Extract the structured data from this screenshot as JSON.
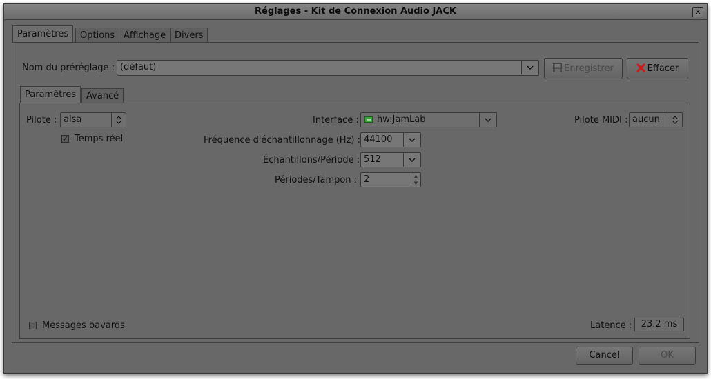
{
  "window": {
    "title": "Réglages - Kit de Connexion Audio JACK",
    "close_glyph": "✕"
  },
  "main_tabs": [
    {
      "label": "Paramètres",
      "active": true
    },
    {
      "label": "Options",
      "active": false
    },
    {
      "label": "Affichage",
      "active": false
    },
    {
      "label": "Divers",
      "active": false
    }
  ],
  "preset": {
    "label": "Nom du préréglage :",
    "value": "(défaut)",
    "save_label": "Enregistrer",
    "save_icon": "floppy-icon",
    "save_disabled": true,
    "delete_label": "Effacer",
    "delete_icon": "red-x-icon"
  },
  "sub_tabs": [
    {
      "label": "Paramètres",
      "active": true
    },
    {
      "label": "Avancé",
      "active": false
    }
  ],
  "settings": {
    "driver_label": "Pilote :",
    "driver_value": "alsa",
    "realtime_label": "Temps réel",
    "realtime_checked": true,
    "interface_label": "Interface :",
    "interface_value": "hw:JamLab",
    "interface_icon": "audio-card-icon",
    "samplerate_label": "Fréquence d'échantillonnage (Hz) :",
    "samplerate_value": "44100",
    "frames_label": "Échantillons/Période :",
    "frames_value": "512",
    "periods_label": "Périodes/Tampon :",
    "periods_value": "2",
    "midi_label": "Pilote MIDI :",
    "midi_value": "aucun",
    "verbose_label": "Messages bavards",
    "verbose_checked": false,
    "latency_label": "Latence :",
    "latency_value": "23.2 ms"
  },
  "footer": {
    "cancel_label": "Cancel",
    "ok_label": "OK",
    "ok_disabled": true
  },
  "colors": {
    "window_bg": "#686868",
    "titlebar": "#6a6a6a",
    "delete_icon": "#d01818",
    "interface_icon": "#3aa33a"
  }
}
